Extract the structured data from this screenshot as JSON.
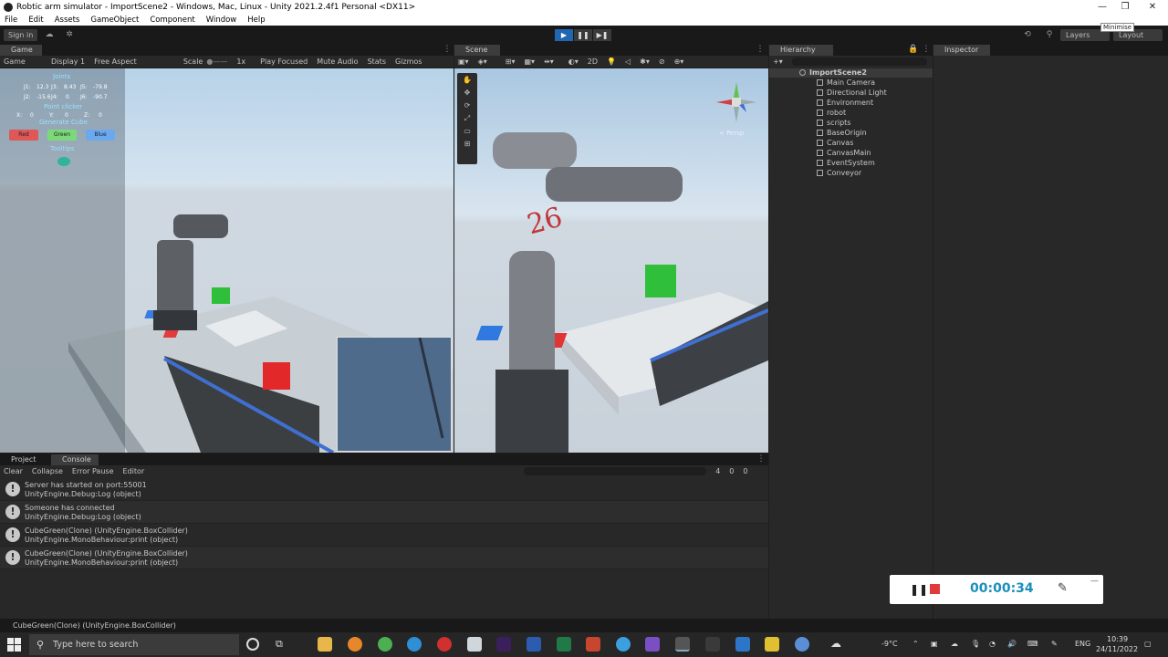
{
  "window": {
    "title": "Robtic arm simulator - ImportScene2 - Windows, Mac, Linux - Unity 2021.2.4f1 Personal <DX11>",
    "tooltip": "Minimise"
  },
  "menu": [
    "File",
    "Edit",
    "Assets",
    "GameObject",
    "Component",
    "Window",
    "Help"
  ],
  "toolbar": {
    "signin": "Sign in",
    "layers": "Layers",
    "layout": "Layout"
  },
  "game": {
    "tab": "Game",
    "bar": {
      "mode": "Game",
      "display": "Display 1",
      "aspect": "Free Aspect",
      "scale_label": "Scale",
      "scale_value": "1x",
      "play_focused": "Play Focused",
      "mute": "Mute Audio",
      "stats": "Stats",
      "gizmos": "Gizmos"
    },
    "ui": {
      "joints_title": "Joints",
      "joints": [
        {
          "label": "J1:",
          "value": "12.3"
        },
        {
          "label": "J3:",
          "value": "8.43"
        },
        {
          "label": "J5:",
          "value": "-79.8"
        },
        {
          "label": "J2:",
          "value": "-15.6"
        },
        {
          "label": "J4:",
          "value": "0"
        },
        {
          "label": "J6:",
          "value": "-90.7"
        }
      ],
      "point_clicker": "Point clicker",
      "coords": [
        {
          "label": "X:",
          "value": "0"
        },
        {
          "label": "Y:",
          "value": "0"
        },
        {
          "label": "Z:",
          "value": "0"
        }
      ],
      "generate_cube": "Generate Cube",
      "buttons": [
        {
          "label": "Red",
          "color": "#e05757"
        },
        {
          "label": "Green",
          "color": "#7bd97a"
        },
        {
          "label": "Blue",
          "color": "#6aa9f0"
        }
      ],
      "tooltips": "Tooltips"
    }
  },
  "scene": {
    "tab": "Scene",
    "persp": "< Persp",
    "mode_2d": "2D",
    "arm_number": "26"
  },
  "hierarchy": {
    "tab": "Hierarchy",
    "root": "ImportScene2",
    "items": [
      "Main Camera",
      "Directional Light",
      "Environment",
      "robot",
      "scripts",
      "BaseOrigin",
      "Canvas",
      "CanvasMain",
      "EventSystem",
      "Conveyor"
    ]
  },
  "inspector": {
    "tab": "Inspector"
  },
  "console": {
    "tabs": [
      "Project",
      "Console"
    ],
    "bar": {
      "clear": "Clear",
      "collapse": "Collapse",
      "error_pause": "Error Pause",
      "editor": "Editor",
      "count_info": "4",
      "count_warn": "0",
      "count_err": "0"
    },
    "logs": [
      {
        "line1": "Server has started on port:55001",
        "line2": "UnityEngine.Debug:Log (object)"
      },
      {
        "line1": "Someone has connected",
        "line2": "UnityEngine.Debug:Log (object)"
      },
      {
        "line1": "CubeGreen(Clone) (UnityEngine.BoxCollider)",
        "line2": "UnityEngine.MonoBehaviour:print (object)"
      },
      {
        "line1": "CubeGreen(Clone) (UnityEngine.BoxCollider)",
        "line2": "UnityEngine.MonoBehaviour:print (object)"
      }
    ]
  },
  "status": {
    "text": "CubeGreen(Clone) (UnityEngine.BoxCollider)"
  },
  "recorder": {
    "time": "00:00:34"
  },
  "taskbar": {
    "search": "Type here to search",
    "weather": "-9°C",
    "lang": "ENG",
    "time": "10:39",
    "date": "24/11/2022"
  }
}
